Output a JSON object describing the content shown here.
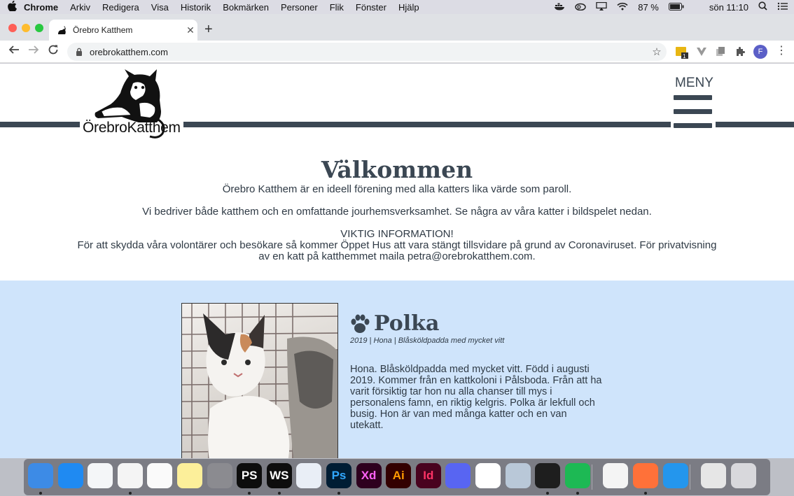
{
  "menubar": {
    "app": "Chrome",
    "items": [
      "Arkiv",
      "Redigera",
      "Visa",
      "Historik",
      "Bokmärken",
      "Personer",
      "Flik",
      "Fönster",
      "Hjälp"
    ],
    "battery": "87 %",
    "clock": "sön 11:10"
  },
  "browser": {
    "tab_title": "Örebro Katthem",
    "url": "orebrokatthem.com",
    "ext_badge": "1",
    "profile_initial": "F"
  },
  "site": {
    "logo_text": "ÖrebroKatthem",
    "menu_label": "MENY",
    "welcome_title": "Välkommen",
    "intro_1": "Örebro Katthem är en ideell förening med alla katters lika värde som paroll.",
    "intro_2": "Vi bedriver både katthem och en omfattande jourhemsverksamhet. Se några av våra katter i bildspelet nedan.",
    "info_heading": "VIKTIG INFORMATION!",
    "info_text": "För att skydda våra volontärer och besökare så kommer Öppet Hus att vara stängt tillsvidare på grund av Coronaviruset. För privatvisning av en katt på katthemmet maila petra@orebrokatthem.com."
  },
  "cat": {
    "name": "Polka",
    "meta": "2019 | Hona | Blåsköldpadda med mycket vitt",
    "description": "Hona. Blåsköldpadda med mycket vitt. Född i augusti 2019. Kommer från en kattkoloni i Pålsboda. Från att ha varit försiktig tar hon nu alla chanser till mys i personalens famn, en riktig kelgris. Polka är lekfull och busig. Hon är van med många katter och en van utekatt."
  },
  "dock": {
    "apps": [
      {
        "name": "finder-icon",
        "label": "",
        "bg": "#3d8be6",
        "fg": "#ffffff"
      },
      {
        "name": "app-store-icon",
        "label": "",
        "bg": "#1f8af2",
        "fg": "#ffffff"
      },
      {
        "name": "safari-icon",
        "label": "",
        "bg": "#f4f6f8",
        "fg": "#1b73e8"
      },
      {
        "name": "chrome-icon",
        "label": "",
        "bg": "#f4f4f4",
        "fg": "#db4437"
      },
      {
        "name": "reminders-icon",
        "label": "",
        "bg": "#fafafa",
        "fg": "#444444"
      },
      {
        "name": "notes-icon",
        "label": "",
        "bg": "#fcef9a",
        "fg": "#777777"
      },
      {
        "name": "system-preferences-icon",
        "label": "",
        "bg": "#8b8b90",
        "fg": "#ffffff"
      },
      {
        "name": "phpstorm-icon",
        "label": "PS",
        "bg": "#0d0d0d",
        "fg": "#ffffff"
      },
      {
        "name": "webstorm-icon",
        "label": "WS",
        "bg": "#0d0d0d",
        "fg": "#ffffff"
      },
      {
        "name": "vscode-icon",
        "label": "",
        "bg": "#e9eef6",
        "fg": "#1d7ad0"
      },
      {
        "name": "photoshop-icon",
        "label": "Ps",
        "bg": "#001d34",
        "fg": "#31a8ff"
      },
      {
        "name": "adobe-xd-icon",
        "label": "Xd",
        "bg": "#2e001e",
        "fg": "#ff61f6"
      },
      {
        "name": "illustrator-icon",
        "label": "Ai",
        "bg": "#330000",
        "fg": "#ff9a00"
      },
      {
        "name": "indesign-icon",
        "label": "Id",
        "bg": "#49021f",
        "fg": "#ff3366"
      },
      {
        "name": "discord-icon",
        "label": "",
        "bg": "#5865f2",
        "fg": "#ffffff"
      },
      {
        "name": "slack-icon",
        "label": "",
        "bg": "#ffffff",
        "fg": "#4a154b"
      },
      {
        "name": "preview-icon",
        "label": "",
        "bg": "#b9c8d8",
        "fg": "#333333"
      },
      {
        "name": "terminal-icon",
        "label": "",
        "bg": "#1e1e1e",
        "fg": "#e6e6e6"
      },
      {
        "name": "spotify-icon",
        "label": "",
        "bg": "#1db954",
        "fg": "#000000"
      },
      {
        "name": "textedit-icon",
        "label": "",
        "bg": "#f4f4f4",
        "fg": "#555555"
      },
      {
        "name": "firefox-icon",
        "label": "",
        "bg": "#ff7139",
        "fg": "#7542e5"
      },
      {
        "name": "docker-icon",
        "label": "",
        "bg": "#2496ed",
        "fg": "#ffffff"
      },
      {
        "name": "documents-folder-icon",
        "label": "",
        "bg": "#e6e6e6",
        "fg": "#333333"
      },
      {
        "name": "trash-icon",
        "label": "",
        "bg": "#d8d8dc",
        "fg": "#666666"
      }
    ]
  },
  "colors": {
    "brand_dark": "#3b4753",
    "section_bg": "#cfe4fb"
  }
}
